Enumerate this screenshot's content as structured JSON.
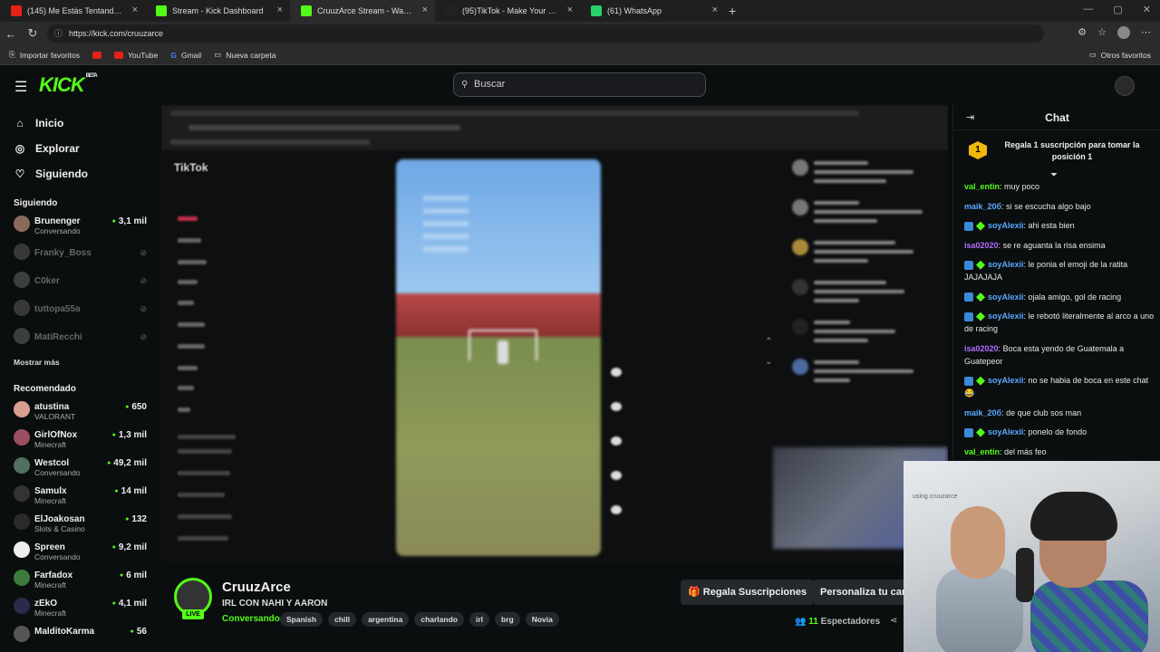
{
  "browser": {
    "tabs": [
      {
        "label": "(145) Me Estás Tentando ( Turreo",
        "color": "#e62117"
      },
      {
        "label": "Stream - Kick Dashboard",
        "color": "#53fc18"
      },
      {
        "label": "CruuzArce Stream - Watch Live o",
        "color": "#53fc18"
      },
      {
        "label": "(95)TikTok - Make Your Day",
        "color": "#222222"
      },
      {
        "label": "(61) WhatsApp",
        "color": "#25d366"
      }
    ],
    "url": "https://kick.com/cruuzarce",
    "bookmarks": [
      "Importar favoritos",
      "YouTube",
      "Gmail",
      "Nueva carpeta"
    ],
    "other_bookmarks": "Otros favoritos"
  },
  "header": {
    "logo": "KICK",
    "logo_badge": "BETA",
    "search_placeholder": "Buscar"
  },
  "sidebar": {
    "nav": [
      {
        "label": "Inicio",
        "icon": "home-icon"
      },
      {
        "label": "Explorar",
        "icon": "compass-icon"
      },
      {
        "label": "Siguiendo",
        "icon": "heart-icon"
      }
    ],
    "following_title": "Siguiendo",
    "following": [
      {
        "name": "Brunenger",
        "category": "Conversando",
        "viewers": "3,1 mil",
        "live": true,
        "color": "#8a6a5a"
      },
      {
        "name": "Franky_Boss",
        "live": false,
        "color": "#777"
      },
      {
        "name": "C0ker",
        "live": false,
        "color": "#888"
      },
      {
        "name": "tuttopa55a",
        "live": false,
        "color": "#777"
      },
      {
        "name": "MatiRecchi",
        "live": false,
        "color": "#888"
      }
    ],
    "show_more": "Mostrar más",
    "recommended_title": "Recomendado",
    "recommended": [
      {
        "name": "atustina",
        "category": "VALORANT",
        "viewers": "650",
        "color": "#d8a090"
      },
      {
        "name": "GirlOfNox",
        "category": "Minecraft",
        "viewers": "1,3 mil",
        "color": "#9a5060"
      },
      {
        "name": "Westcol",
        "category": "Conversando",
        "viewers": "49,2 mil",
        "color": "#507060"
      },
      {
        "name": "Samulx",
        "category": "Minecraft",
        "viewers": "14 mil",
        "color": "#333"
      },
      {
        "name": "ElJoakosan",
        "category": "Slots & Casino",
        "viewers": "132",
        "color": "#2a2a2a"
      },
      {
        "name": "Spreen",
        "category": "Conversando",
        "viewers": "9,2 mil",
        "color": "#eee"
      },
      {
        "name": "Farfadox",
        "category": "Minecraft",
        "viewers": "6 mil",
        "color": "#3a7a3a"
      },
      {
        "name": "zEkO",
        "category": "Minecraft",
        "viewers": "4,1 mil",
        "color": "#2a2a4a"
      },
      {
        "name": "MalditoKarma",
        "category": "",
        "viewers": "56",
        "color": "#555"
      }
    ]
  },
  "video": {
    "inner_logo": "TikTok"
  },
  "stream": {
    "name": "CruuzArce",
    "live_badge": "LIVE",
    "title": "IRL CON NAHI Y AARON",
    "category": "Conversando",
    "tags": [
      "Spanish",
      "chill",
      "argentina",
      "charlando",
      "irl",
      "brg",
      "Novia"
    ],
    "gift_button": "Regala Suscripciones",
    "personalize_button": "Personaliza tu car",
    "viewer_count": "11",
    "viewer_label": "Espectadores"
  },
  "chat": {
    "title": "Chat",
    "pinned_rank": "1",
    "pinned_text": "Regala 1 suscripción para tomar la posición 1",
    "messages": [
      {
        "user": "val_entin",
        "color": "#53fc18",
        "text": "muy poco",
        "badges": false
      },
      {
        "user": "maik_20б",
        "color": "#5aa8ff",
        "text": "si se escucha algo bajo",
        "badges": false
      },
      {
        "user": "soyAlexii",
        "color": "#5aa8ff",
        "text": "ahi esta bien",
        "badges": true
      },
      {
        "user": "isa02020",
        "color": "#b06cff",
        "text": "se re aguanta la risa ensima",
        "badges": false
      },
      {
        "user": "soyAlexii",
        "color": "#5aa8ff",
        "text": "le ponia el emoji de la ratita JAJAJAJA",
        "badges": true
      },
      {
        "user": "soyAlexii",
        "color": "#5aa8ff",
        "text": "ojala amigo, gol de racing",
        "badges": true
      },
      {
        "user": "soyAlexii",
        "color": "#5aa8ff",
        "text": "le rebotó literalmente al arco a uno de racing",
        "badges": true
      },
      {
        "user": "isa02020",
        "color": "#b06cff",
        "text": "Boca esta yendo de Guatemala a Guatepeor",
        "badges": false
      },
      {
        "user": "soyAlexii",
        "color": "#5aa8ff",
        "text": "no se habia de boca en este chat 😂",
        "badges": true
      },
      {
        "user": "maik_20б",
        "color": "#5aa8ff",
        "text": "de que club sos man",
        "badges": false
      },
      {
        "user": "soyAlexii",
        "color": "#5aa8ff",
        "text": "ponelo de fondo",
        "badges": true
      },
      {
        "user": "val_entin",
        "color": "#53fc18",
        "text": "del más feo",
        "badges": false
      }
    ]
  },
  "facecam": {
    "overlay_text": "using cruuzarce"
  }
}
